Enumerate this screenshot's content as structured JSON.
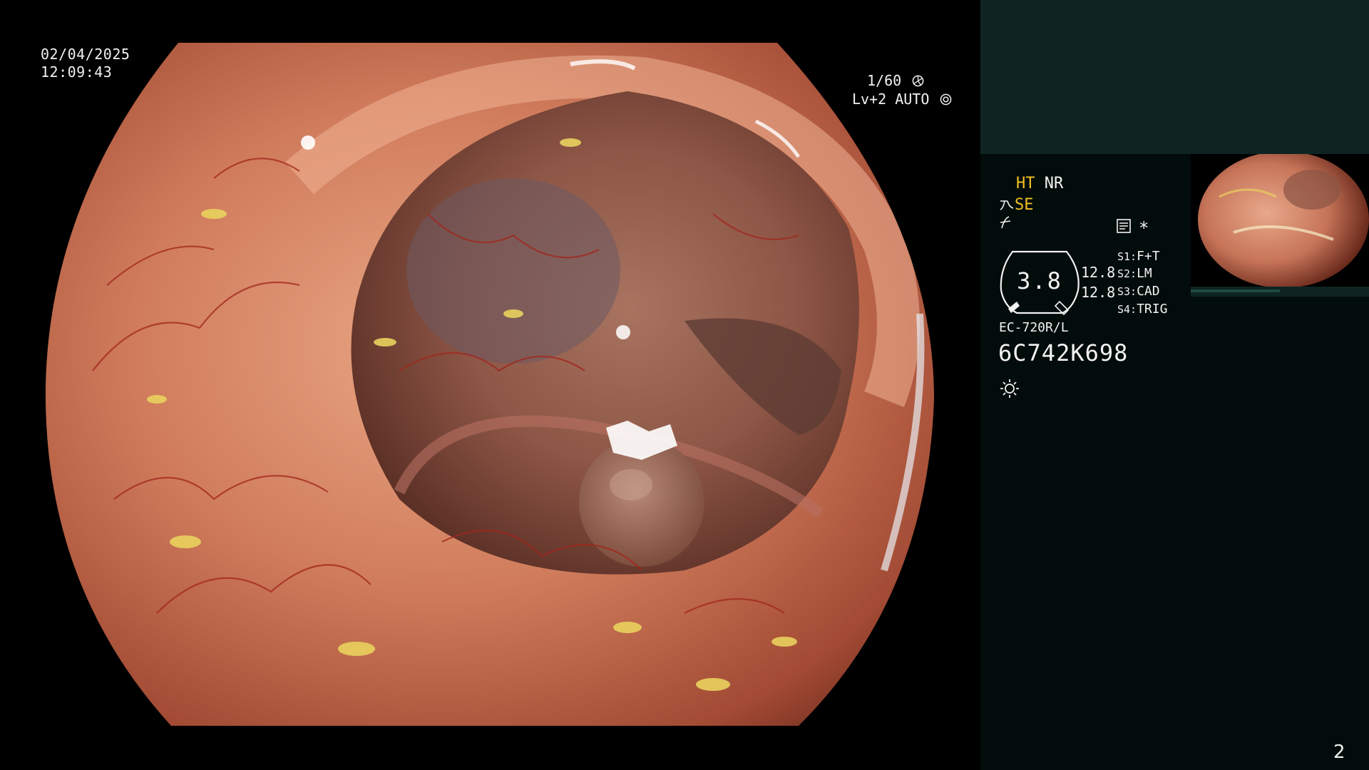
{
  "overlay": {
    "date": "02/04/2025",
    "time": "12:09:43",
    "shutter": "1/60",
    "shutter_icon": "shutter-icon",
    "level": "Lv+2 AUTO",
    "level_icon": "auto-iris-icon"
  },
  "info_panel": {
    "mode_ht": "HT",
    "mode_nr": "NR",
    "mode_se": "SE",
    "se_icon": "enhance-icon",
    "freeze_icon": "freeze-icon",
    "memo_icon": "memo-icon",
    "star": "*",
    "gauge_value": "3.8",
    "value_1": "12.8",
    "value_2": "12.8",
    "switches": [
      {
        "key": "S1:",
        "label": "F+T"
      },
      {
        "key": "S2:",
        "label": "LM"
      },
      {
        "key": "S3:",
        "label": "CAD"
      },
      {
        "key": "S4:",
        "label": "TRIG"
      }
    ],
    "scope_model": "EC-720R/L",
    "scope_serial": "6C742K698",
    "light_icon": "light-source-icon"
  },
  "page_number": "2",
  "colors": {
    "panel_background": "#020c0b",
    "panel_header": "#0d2422",
    "accent_yellow": "#f2c020",
    "mucosa": "#c46a4e"
  }
}
